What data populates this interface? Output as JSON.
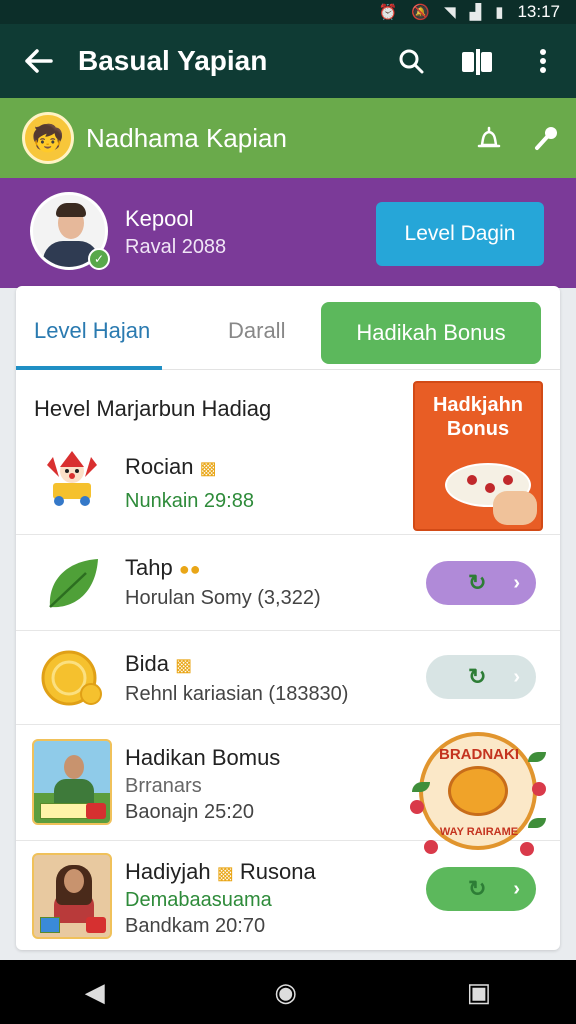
{
  "status_bar": {
    "time": "13:17"
  },
  "app_bar": {
    "title": "Basual Yapian",
    "icons": [
      "back-arrow-icon",
      "search-icon",
      "compare-icon",
      "more-vert-icon"
    ]
  },
  "profile_bar": {
    "name": "Nadhama Kapian",
    "icons": [
      "bell-icon",
      "mic-icon"
    ]
  },
  "user": {
    "name": "Kepool",
    "sub": "Raval 2088",
    "button": "Level Dagin"
  },
  "tabs": [
    {
      "label": "Level Hajan",
      "active": true
    },
    {
      "label": "Darall",
      "active": false
    },
    {
      "label": "Hadikah Bonus",
      "active": false
    }
  ],
  "section_title": "Hevel Marjarbun Hadiag",
  "promo": {
    "title": "Hadkjahn Bonus"
  },
  "items": [
    {
      "title": "Rocian",
      "subtitle": "Nunkain 29:88",
      "icon": "jester-icon"
    },
    {
      "title": "Tahp",
      "subtitle": "Horulan Somy (3,322)",
      "icon": "leaf-icon"
    },
    {
      "title": "Bida",
      "subtitle": "Rehnl kariasian (183830)",
      "icon": "coin-icon"
    },
    {
      "title": "Hadikan Bomus",
      "subtitle": "Brranars",
      "subtitle2": "Baonajn 25:20",
      "icon": "photo-man"
    },
    {
      "title": "Hadiyjah",
      "title_extra": "Rusona",
      "subtitle": "Demabaasuama",
      "subtitle2": "Bandkam 20:70",
      "icon": "photo-woman"
    }
  ],
  "roundel": {
    "top": "BRADNAKI",
    "bottom": "WAY RAIRAME"
  },
  "colors": {
    "app_bar": "#0f3b34",
    "green_band": "#6aaa4b",
    "purple_band": "#7b3a98",
    "accent_blue": "#26a6d8",
    "tab_green": "#5cb85c",
    "pill_purple": "#b08ad8",
    "pill_grey": "#d8e4e4",
    "pill_green": "#5cb85c"
  }
}
